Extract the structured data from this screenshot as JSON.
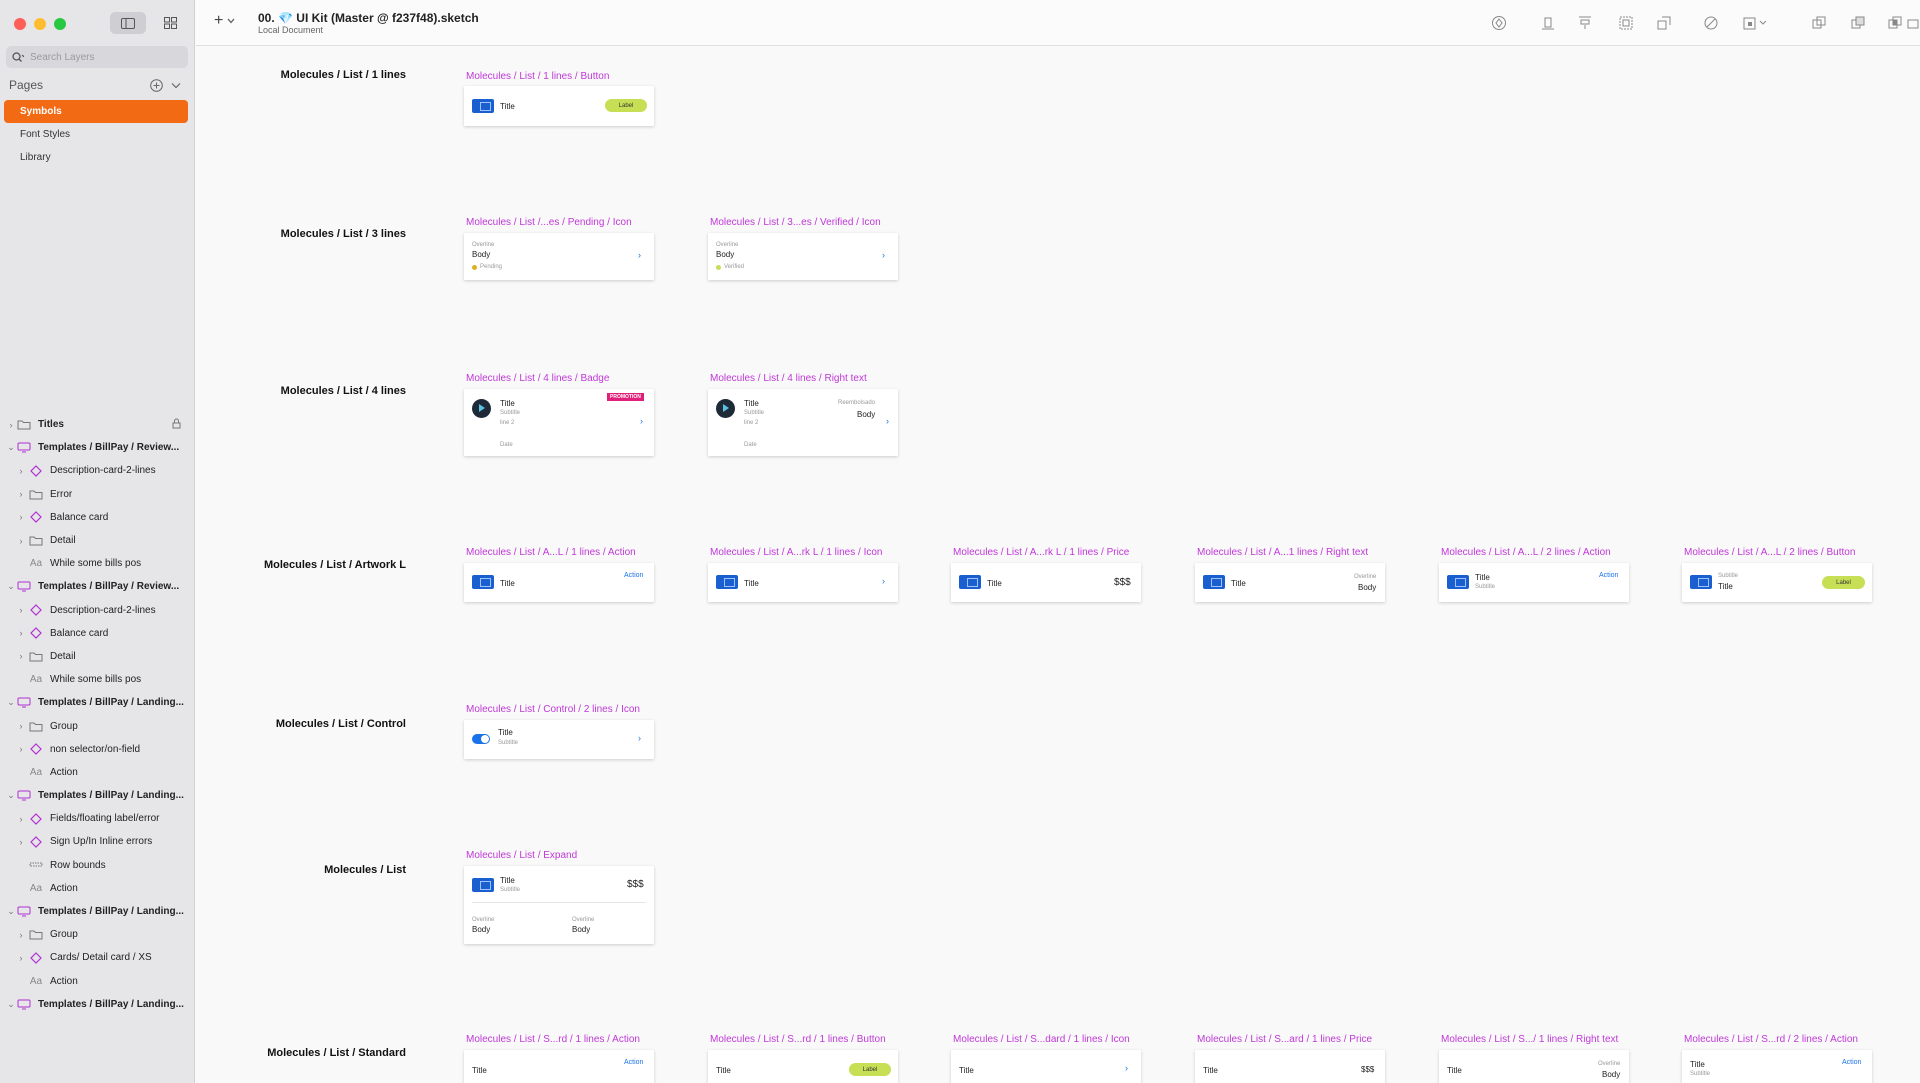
{
  "window": {
    "title": "00. 💎 UI Kit (Master @ f237f48).sketch",
    "subtitle": "Local Document"
  },
  "sidebar": {
    "search_placeholder": "Search Layers",
    "pages_label": "Pages",
    "pages": [
      {
        "label": "Symbols",
        "active": true
      },
      {
        "label": "Font Styles",
        "active": false
      },
      {
        "label": "Library",
        "active": false
      }
    ],
    "layers": [
      {
        "label": "Titles",
        "level": "top",
        "icon": "folder-icon"
      },
      {
        "label": "Templates / BillPay / Review...",
        "level": "top",
        "icon": "artboard-icon"
      },
      {
        "label": "Description-card-2-lines",
        "level": "child",
        "icon": "symbol-icon"
      },
      {
        "label": "Error",
        "level": "child",
        "icon": "folder-icon"
      },
      {
        "label": "Balance card",
        "level": "child",
        "icon": "symbol-icon"
      },
      {
        "label": "Detail",
        "level": "child",
        "icon": "folder-icon"
      },
      {
        "label": "While some bills pos",
        "level": "child",
        "icon": "text-icon"
      },
      {
        "label": "Templates / BillPay / Review...",
        "level": "top",
        "icon": "artboard-icon"
      },
      {
        "label": "Description-card-2-lines",
        "level": "child",
        "icon": "symbol-icon"
      },
      {
        "label": "Balance card",
        "level": "child",
        "icon": "symbol-icon"
      },
      {
        "label": "Detail",
        "level": "child",
        "icon": "folder-icon"
      },
      {
        "label": "While some bills pos",
        "level": "child",
        "icon": "text-icon"
      },
      {
        "label": "Templates / BillPay / Landing...",
        "level": "top",
        "icon": "artboard-icon"
      },
      {
        "label": "Group",
        "level": "child",
        "icon": "folder-icon"
      },
      {
        "label": "non selector/on-field",
        "level": "child",
        "icon": "symbol-icon"
      },
      {
        "label": "Action",
        "level": "child",
        "icon": "text-icon"
      },
      {
        "label": "Templates / BillPay / Landing...",
        "level": "top",
        "icon": "artboard-icon"
      },
      {
        "label": "Fields/floating label/error",
        "level": "child",
        "icon": "symbol-icon"
      },
      {
        "label": "Sign Up/In Inline errors",
        "level": "child",
        "icon": "symbol-icon"
      },
      {
        "label": "Row bounds",
        "level": "child",
        "icon": "shape-icon"
      },
      {
        "label": "Action",
        "level": "child",
        "icon": "text-icon"
      },
      {
        "label": "Templates / BillPay / Landing...",
        "level": "top",
        "icon": "artboard-icon"
      },
      {
        "label": "Group",
        "level": "child",
        "icon": "folder-icon"
      },
      {
        "label": "Cards/ Detail card / XS",
        "level": "child",
        "icon": "symbol-icon"
      },
      {
        "label": "Action",
        "level": "child",
        "icon": "text-icon"
      },
      {
        "label": "Templates / BillPay / Landing...",
        "level": "top",
        "icon": "artboard-icon"
      }
    ]
  },
  "canvas": {
    "rows": [
      {
        "label": "Molecules / List / 1 lines"
      },
      {
        "label": "Molecules / List / 3 lines"
      },
      {
        "label": "Molecules / List / 4 lines"
      },
      {
        "label": "Molecules / List / Artwork L"
      },
      {
        "label": "Molecules / List / Control"
      },
      {
        "label": "Molecules / List"
      },
      {
        "label": "Molecules / List / Standard"
      }
    ],
    "artboards": {
      "r1c1": {
        "label": "Molecules / List / 1 lines / Button",
        "title": "Title",
        "pill": "Label"
      },
      "r2c1": {
        "label": "Molecules / List /...es / Pending / Icon",
        "overline": "Overline",
        "body": "Body",
        "status": "Pending"
      },
      "r2c2": {
        "label": "Molecules / List / 3...es / Verified / Icon",
        "overline": "Overline",
        "body": "Body",
        "status": "Verified"
      },
      "r3c1": {
        "label": "Molecules / List / 4 lines / Badge",
        "title": "Title",
        "subtitle": "Subtitle",
        "line2": "line 2",
        "date": "Date",
        "badge": "PROMOTION"
      },
      "r3c2": {
        "label": "Molecules / List / 4 lines / Right text",
        "title": "Title",
        "subtitle": "Subtitle",
        "line2": "line 2",
        "date": "Date",
        "right_over": "Reembolsado",
        "right_body": "Body"
      },
      "r4c1": {
        "label": "Molecules / List / A...L / 1 lines / Action",
        "title": "Title",
        "action": "Action"
      },
      "r4c2": {
        "label": "Molecules / List / A...rk L / 1 lines / Icon",
        "title": "Title"
      },
      "r4c3": {
        "label": "Molecules / List / A...rk L / 1 lines / Price",
        "title": "Title",
        "price": "$$$"
      },
      "r4c4": {
        "label": "Molecules / List / A...1 lines / Right text",
        "title": "Title",
        "overline": "Overline",
        "body": "Body"
      },
      "r4c5": {
        "label": "Molecules / List / A...L / 2 lines / Action",
        "title": "Title",
        "subtitle": "Subtitle",
        "action": "Action"
      },
      "r4c6": {
        "label": "Molecules / List / A...L / 2 lines / Button",
        "subtitle": "Subtitle",
        "title": "Title",
        "pill": "Label"
      },
      "r5c1": {
        "label": "Molecules / List / Control / 2 lines / Icon",
        "title": "Title",
        "subtitle": "Subtitle"
      },
      "r6c1": {
        "label": "Molecules / List / Expand",
        "title": "Title",
        "subtitle": "Subtitle",
        "price": "$$$",
        "overline1": "Overline",
        "body1": "Body",
        "overline2": "Overline",
        "body2": "Body"
      },
      "r7c1": {
        "label": "Molecules / List / S...rd / 1 lines / Action",
        "title": "Title",
        "action": "Action"
      },
      "r7c2": {
        "label": "Molecules / List / S...rd / 1 lines / Button",
        "title": "Title",
        "pill": "Label"
      },
      "r7c3": {
        "label": "Molecules / List / S...dard / 1 lines / Icon",
        "title": "Title"
      },
      "r7c4": {
        "label": "Molecules / List / S...ard / 1 lines / Price",
        "title": "Title",
        "price": "$$$"
      },
      "r7c5": {
        "label": "Molecules / List / S.../ 1 lines / Right text",
        "title": "Title",
        "overline": "Overline",
        "body": "Body"
      },
      "r7c6": {
        "label": "Molecules / List / S...rd / 2 lines / Action",
        "title": "Title",
        "subtitle": "Subtitle",
        "action": "Action"
      }
    }
  },
  "colors": {
    "accent": "#f26a14",
    "artboard_label": "#c038d8",
    "link": "#1a73e8",
    "pill": "#c7df55",
    "badge": "#e0207a",
    "pending": "#e0b020",
    "verified": "#c7df55"
  }
}
